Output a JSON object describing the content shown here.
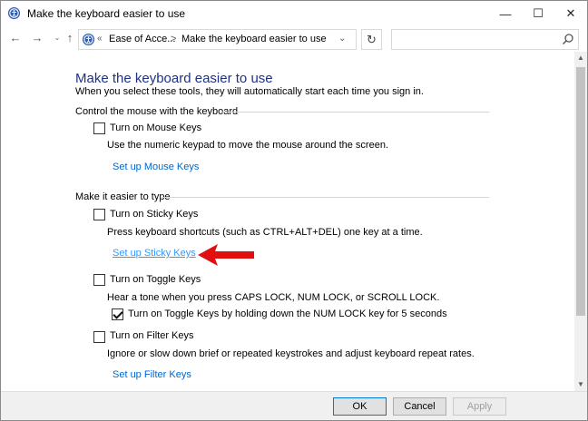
{
  "window": {
    "title": "Make the keyboard easier to use",
    "controls": {
      "minimize": "—",
      "maximize": "☐",
      "close": "✕"
    }
  },
  "nav": {
    "back": "←",
    "forward": "→",
    "recent": "⌄",
    "up": "↑",
    "breadcrumb_prefix": "«",
    "breadcrumb": [
      "Ease of Acce...",
      "Make the keyboard easier to use"
    ],
    "breadcrumb_separator": ">",
    "address_dropdown": "⌄",
    "refresh": "↻",
    "search_placeholder": ""
  },
  "page": {
    "title": "Make the keyboard easier to use",
    "subtitle": "When you select these tools, they will automatically start each time you sign in."
  },
  "sections": [
    {
      "heading": "Control the mouse with the keyboard",
      "items": [
        {
          "label": "Turn on Mouse Keys",
          "checked": false,
          "description": "Use the numeric keypad to move the mouse around the screen.",
          "link": "Set up Mouse Keys"
        }
      ]
    },
    {
      "heading": "Make it easier to type",
      "items": [
        {
          "label": "Turn on Sticky Keys",
          "checked": false,
          "description": "Press keyboard shortcuts (such as CTRL+ALT+DEL) one key at a time.",
          "link": "Set up Sticky Keys"
        },
        {
          "label": "Turn on Toggle Keys",
          "checked": false,
          "description": "Hear a tone when you press CAPS LOCK, NUM LOCK, or SCROLL LOCK.",
          "sub_option": {
            "label": "Turn on Toggle Keys by holding down the NUM LOCK key for 5 seconds",
            "checked": true
          }
        },
        {
          "label": "Turn on Filter Keys",
          "checked": false,
          "description": "Ignore or slow down brief or repeated keystrokes and adjust keyboard repeat rates.",
          "link": "Set up Filter Keys"
        }
      ]
    }
  ],
  "footer": {
    "ok": "OK",
    "cancel": "Cancel",
    "apply": "Apply"
  },
  "colors": {
    "title_blue": "#1e3287",
    "link_blue": "#0066cc",
    "annotation_red": "#e01010"
  }
}
